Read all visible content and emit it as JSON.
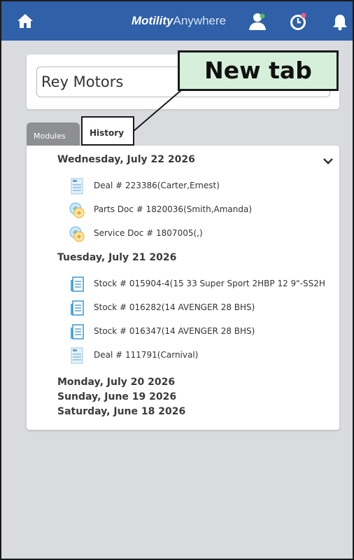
{
  "header": {
    "brand_bold": "Motility",
    "brand_light": "Anywhere",
    "icons": [
      "home-icon",
      "user-icon",
      "clock-icon",
      "bell-icon"
    ],
    "color": "#2f60a8"
  },
  "company": {
    "value": "Rey Motors"
  },
  "callout": {
    "text": "New tab"
  },
  "tabs": [
    {
      "label": "Modules",
      "active": false
    },
    {
      "label": "History",
      "active": true
    }
  ],
  "history": {
    "groups": [
      {
        "date": "Wednesday, July 22 2026",
        "items": [
          {
            "icon": "deal-document-icon",
            "text": "Deal # 223386(Carter,Ernest)"
          },
          {
            "icon": "parts-document-icon",
            "text": "Parts Doc # 1820036(Smith,Amanda)"
          },
          {
            "icon": "service-document-icon",
            "text": "Service Doc # 1807005(,)"
          }
        ]
      },
      {
        "date": "Tuesday, July 21 2026",
        "items": [
          {
            "icon": "stock-icon",
            "text": "Stock # 015904-4(15 33 Super Sport 2HBP 12 9\"-SS2H"
          },
          {
            "icon": "stock-icon",
            "text": "Stock # 016282(14 AVENGER 28 BHS)"
          },
          {
            "icon": "stock-icon",
            "text": "Stock # 016347(14 AVENGER 28 BHS)"
          },
          {
            "icon": "deal-document-icon",
            "text": "Deal # 111791(Carnival)"
          }
        ]
      },
      {
        "date": "Monday, July 20 2026",
        "items": []
      },
      {
        "date": "Sunday, June 19 2026",
        "items": []
      },
      {
        "date": "Saturday, June 18 2026",
        "items": []
      }
    ]
  }
}
